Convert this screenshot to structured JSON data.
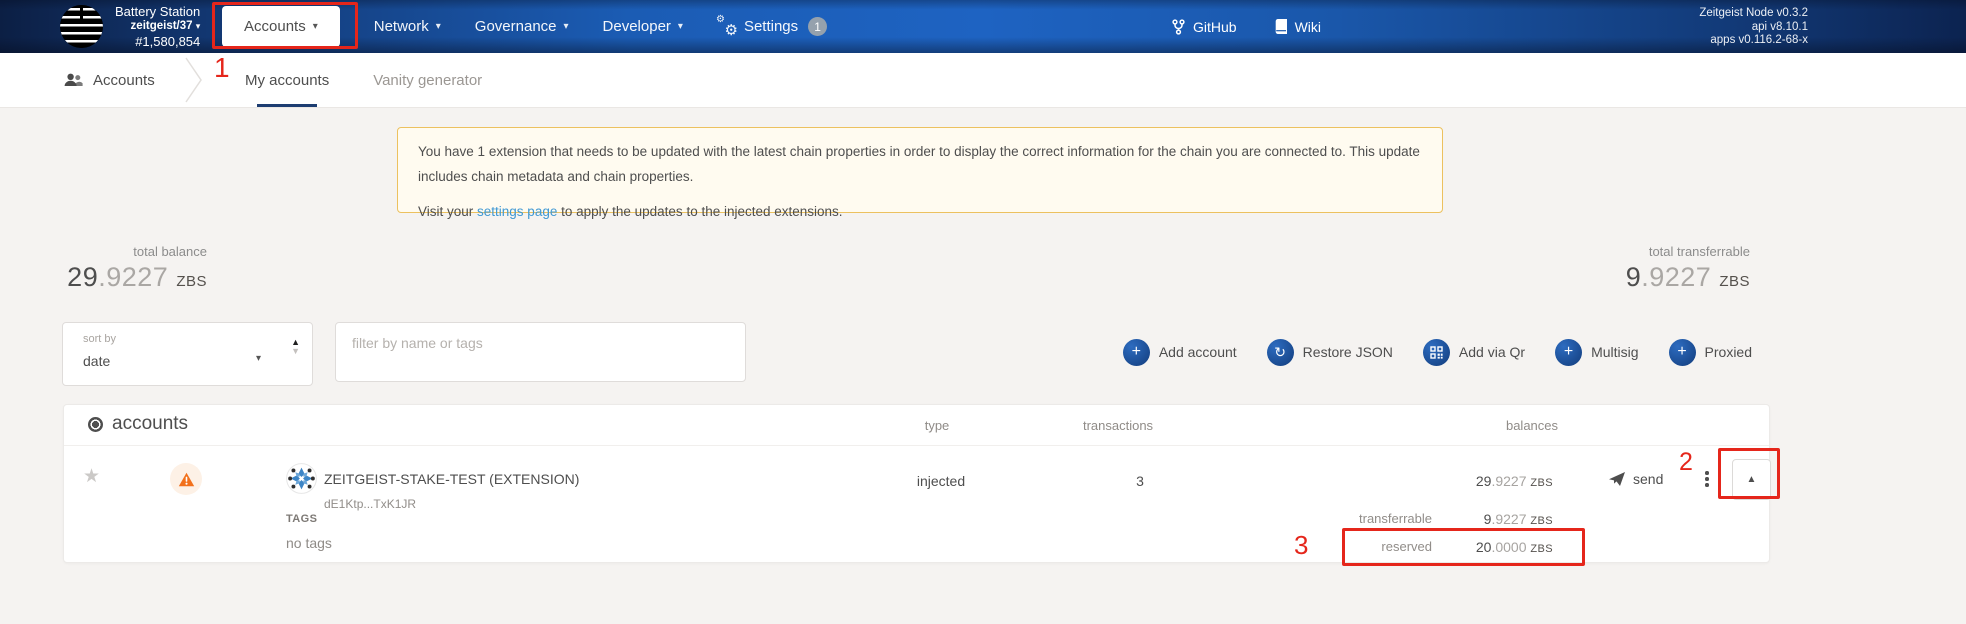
{
  "topbar": {
    "chain": {
      "name": "Battery Station",
      "network": "zeitgeist/37",
      "block": "#1,580,854"
    },
    "menus": [
      {
        "label": "Accounts"
      },
      {
        "label": "Network"
      },
      {
        "label": "Governance"
      },
      {
        "label": "Developer"
      },
      {
        "label": "Settings",
        "badge": "1"
      }
    ],
    "links": [
      {
        "label": "GitHub"
      },
      {
        "label": "Wiki"
      }
    ],
    "versions": [
      "Zeitgeist Node v0.3.2",
      "api v8.10.1",
      "apps v0.116.2-68-x"
    ]
  },
  "tabbar": {
    "breadcrumb": "Accounts",
    "tabs": [
      {
        "label": "My accounts"
      },
      {
        "label": "Vanity generator"
      }
    ]
  },
  "banner": {
    "p1": "You have 1 extension that needs to be updated with the latest chain properties in order to display the correct information for the chain you are connected to. This update includes chain metadata and chain properties.",
    "p2_pre": "Visit your ",
    "p2_link": "settings page",
    "p2_post": " to apply the updates to the injected extensions."
  },
  "summary": {
    "left_label": "total balance",
    "left_int": "29",
    "left_dec": ".9227",
    "right_label": "total transferrable",
    "right_int": "9",
    "right_dec": ".9227",
    "unit": "ZBS"
  },
  "controls": {
    "sort_label": "sort by",
    "sort_value": "date",
    "filter_placeholder": "filter by name or tags",
    "buttons": [
      "Add account",
      "Restore JSON",
      "Add via Qr",
      "Multisig",
      "Proxied"
    ]
  },
  "table": {
    "title": "accounts",
    "headers": {
      "type": "type",
      "transactions": "transactions",
      "balances": "balances"
    },
    "unit": "ZBS",
    "row": {
      "name": "ZEITGEIST-STAKE-TEST (EXTENSION)",
      "address": "dE1Ktp...TxK1JR",
      "type": "injected",
      "transactions": "3",
      "balance_int": "29",
      "balance_dec": ".9227",
      "send_label": "send",
      "tags_label": "TAGS",
      "tags_value": "no tags",
      "details": [
        {
          "label": "transferrable",
          "int": "9",
          "dec": ".9227"
        },
        {
          "label": "reserved",
          "int": "20",
          "dec": ".0000"
        }
      ]
    }
  },
  "annotations": {
    "n1": "1",
    "n2": "2",
    "n3": "3"
  },
  "icons": {
    "caret_down": "▾",
    "caret_up": "▲",
    "caret_down_small": "▼",
    "gear": "⚙",
    "star": "★",
    "plus": "+",
    "sync": "↻"
  },
  "colors": {
    "annotation_red": "#e5261b",
    "accent_blue": "#1e63c2",
    "warning_border": "#ecc15f"
  }
}
